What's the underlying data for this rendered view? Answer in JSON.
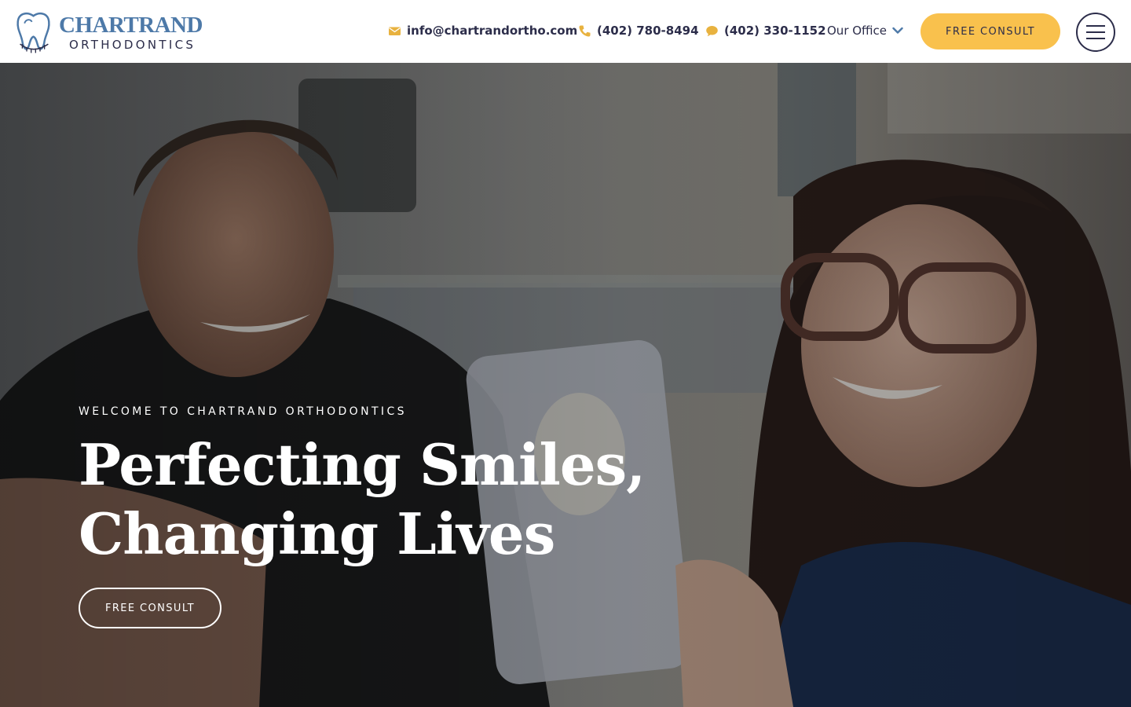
{
  "header": {
    "logo": {
      "title": "CHARTRAND",
      "subtitle": "ORTHODONTICS"
    },
    "email": {
      "icon": "envelope-icon",
      "label": "info@chartrandortho.com"
    },
    "phone": {
      "icon": "phone-icon",
      "label": "(402) 780-8494"
    },
    "text_line": {
      "icon": "chat-bubble-icon",
      "label": "(402) 330-1152"
    },
    "office_menu": {
      "label": "Our Office",
      "icon": "chevron-down-icon"
    },
    "consult_button": "FREE CONSULT",
    "menu_button_icon": "hamburger-menu-icon"
  },
  "hero": {
    "eyebrow": "WELCOME TO CHARTRAND ORTHODONTICS",
    "headline_line1": "Perfecting Smiles,",
    "headline_line2": "Changing Lives",
    "cta_button": "FREE CONSULT"
  },
  "colors": {
    "brand_blue": "#4d79a8",
    "navy_text": "#2c2d4a",
    "accent_yellow": "#f9c14d",
    "icon_gold": "#e8b23f"
  }
}
